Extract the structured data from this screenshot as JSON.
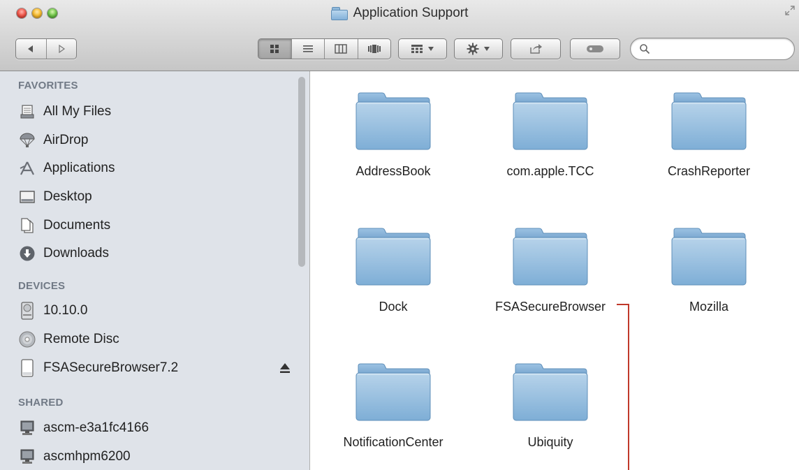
{
  "window": {
    "title": "Application Support"
  },
  "toolbar": {
    "back_icon": "back-arrow-icon",
    "forward_icon": "forward-arrow-icon",
    "view_modes": [
      "icon-view-icon",
      "list-view-icon",
      "column-view-icon",
      "coverflow-view-icon"
    ],
    "active_view": "icon",
    "arrange_icon": "arrange-grid-icon",
    "action_icon": "gear-icon",
    "share_icon": "share-icon",
    "tags_icon": "tags-icon",
    "search": {
      "value": "",
      "placeholder": ""
    }
  },
  "sidebar": {
    "sections": [
      {
        "title": "FAVORITES",
        "items": [
          {
            "label": "All My Files",
            "icon": "all-files-icon"
          },
          {
            "label": "AirDrop",
            "icon": "airdrop-icon"
          },
          {
            "label": "Applications",
            "icon": "applications-icon"
          },
          {
            "label": "Desktop",
            "icon": "desktop-icon"
          },
          {
            "label": "Documents",
            "icon": "documents-icon"
          },
          {
            "label": "Downloads",
            "icon": "downloads-icon"
          }
        ]
      },
      {
        "title": "DEVICES",
        "items": [
          {
            "label": "10.10.0",
            "icon": "hard-drive-icon"
          },
          {
            "label": "Remote Disc",
            "icon": "disc-icon"
          },
          {
            "label": "FSASecureBrowser7.2",
            "icon": "disk-image-icon",
            "ejectable": true
          }
        ]
      },
      {
        "title": "SHARED",
        "items": [
          {
            "label": "ascm-e3a1fc4166",
            "icon": "network-computer-icon"
          },
          {
            "label": "ascmhpm6200",
            "icon": "network-computer-icon"
          }
        ]
      }
    ]
  },
  "content": {
    "folders": [
      {
        "name": "AddressBook"
      },
      {
        "name": "com.apple.TCC"
      },
      {
        "name": "CrashReporter"
      },
      {
        "name": "Dock"
      },
      {
        "name": "FSASecureBrowser"
      },
      {
        "name": "Mozilla"
      },
      {
        "name": "NotificationCenter"
      },
      {
        "name": "Ubiquity"
      }
    ],
    "annotation_color": "#c0392b"
  },
  "colors": {
    "sidebar_bg": "#dfe3e9",
    "section_header": "#717a86",
    "folder_blue": "#8fb8da"
  }
}
